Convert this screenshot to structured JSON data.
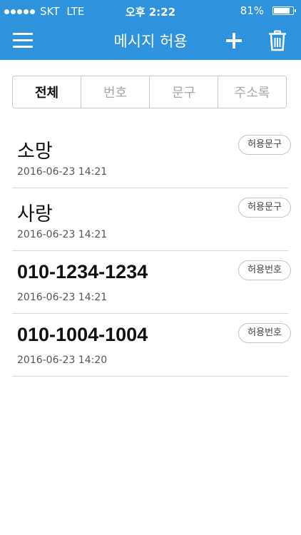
{
  "status": {
    "carrier": "SKT",
    "network": "LTE",
    "time": "오후 2:22",
    "battery": "81%"
  },
  "nav": {
    "title": "메시지 허용",
    "icons": [
      "menu-icon",
      "add-icon",
      "trash-icon"
    ]
  },
  "tabs": [
    {
      "label": "전체",
      "active": true
    },
    {
      "label": "번호",
      "active": false
    },
    {
      "label": "문구",
      "active": false
    },
    {
      "label": "주소록",
      "active": false
    }
  ],
  "items": [
    {
      "name": "소망",
      "date": "2016-06-23 14:21",
      "badge": "허용문구"
    },
    {
      "name": "사랑",
      "date": "2016-06-23 14:21",
      "badge": "허용문구"
    },
    {
      "name": "010-1234-1234",
      "date": "2016-06-23 14:21",
      "badge": "허용번호"
    },
    {
      "name": "010-1004-1004",
      "date": "2016-06-23 14:20",
      "badge": "허용번호"
    }
  ],
  "colors": {
    "accent": "#2f92dc",
    "background": "#ffffff",
    "divider": "#d8d8d8"
  }
}
